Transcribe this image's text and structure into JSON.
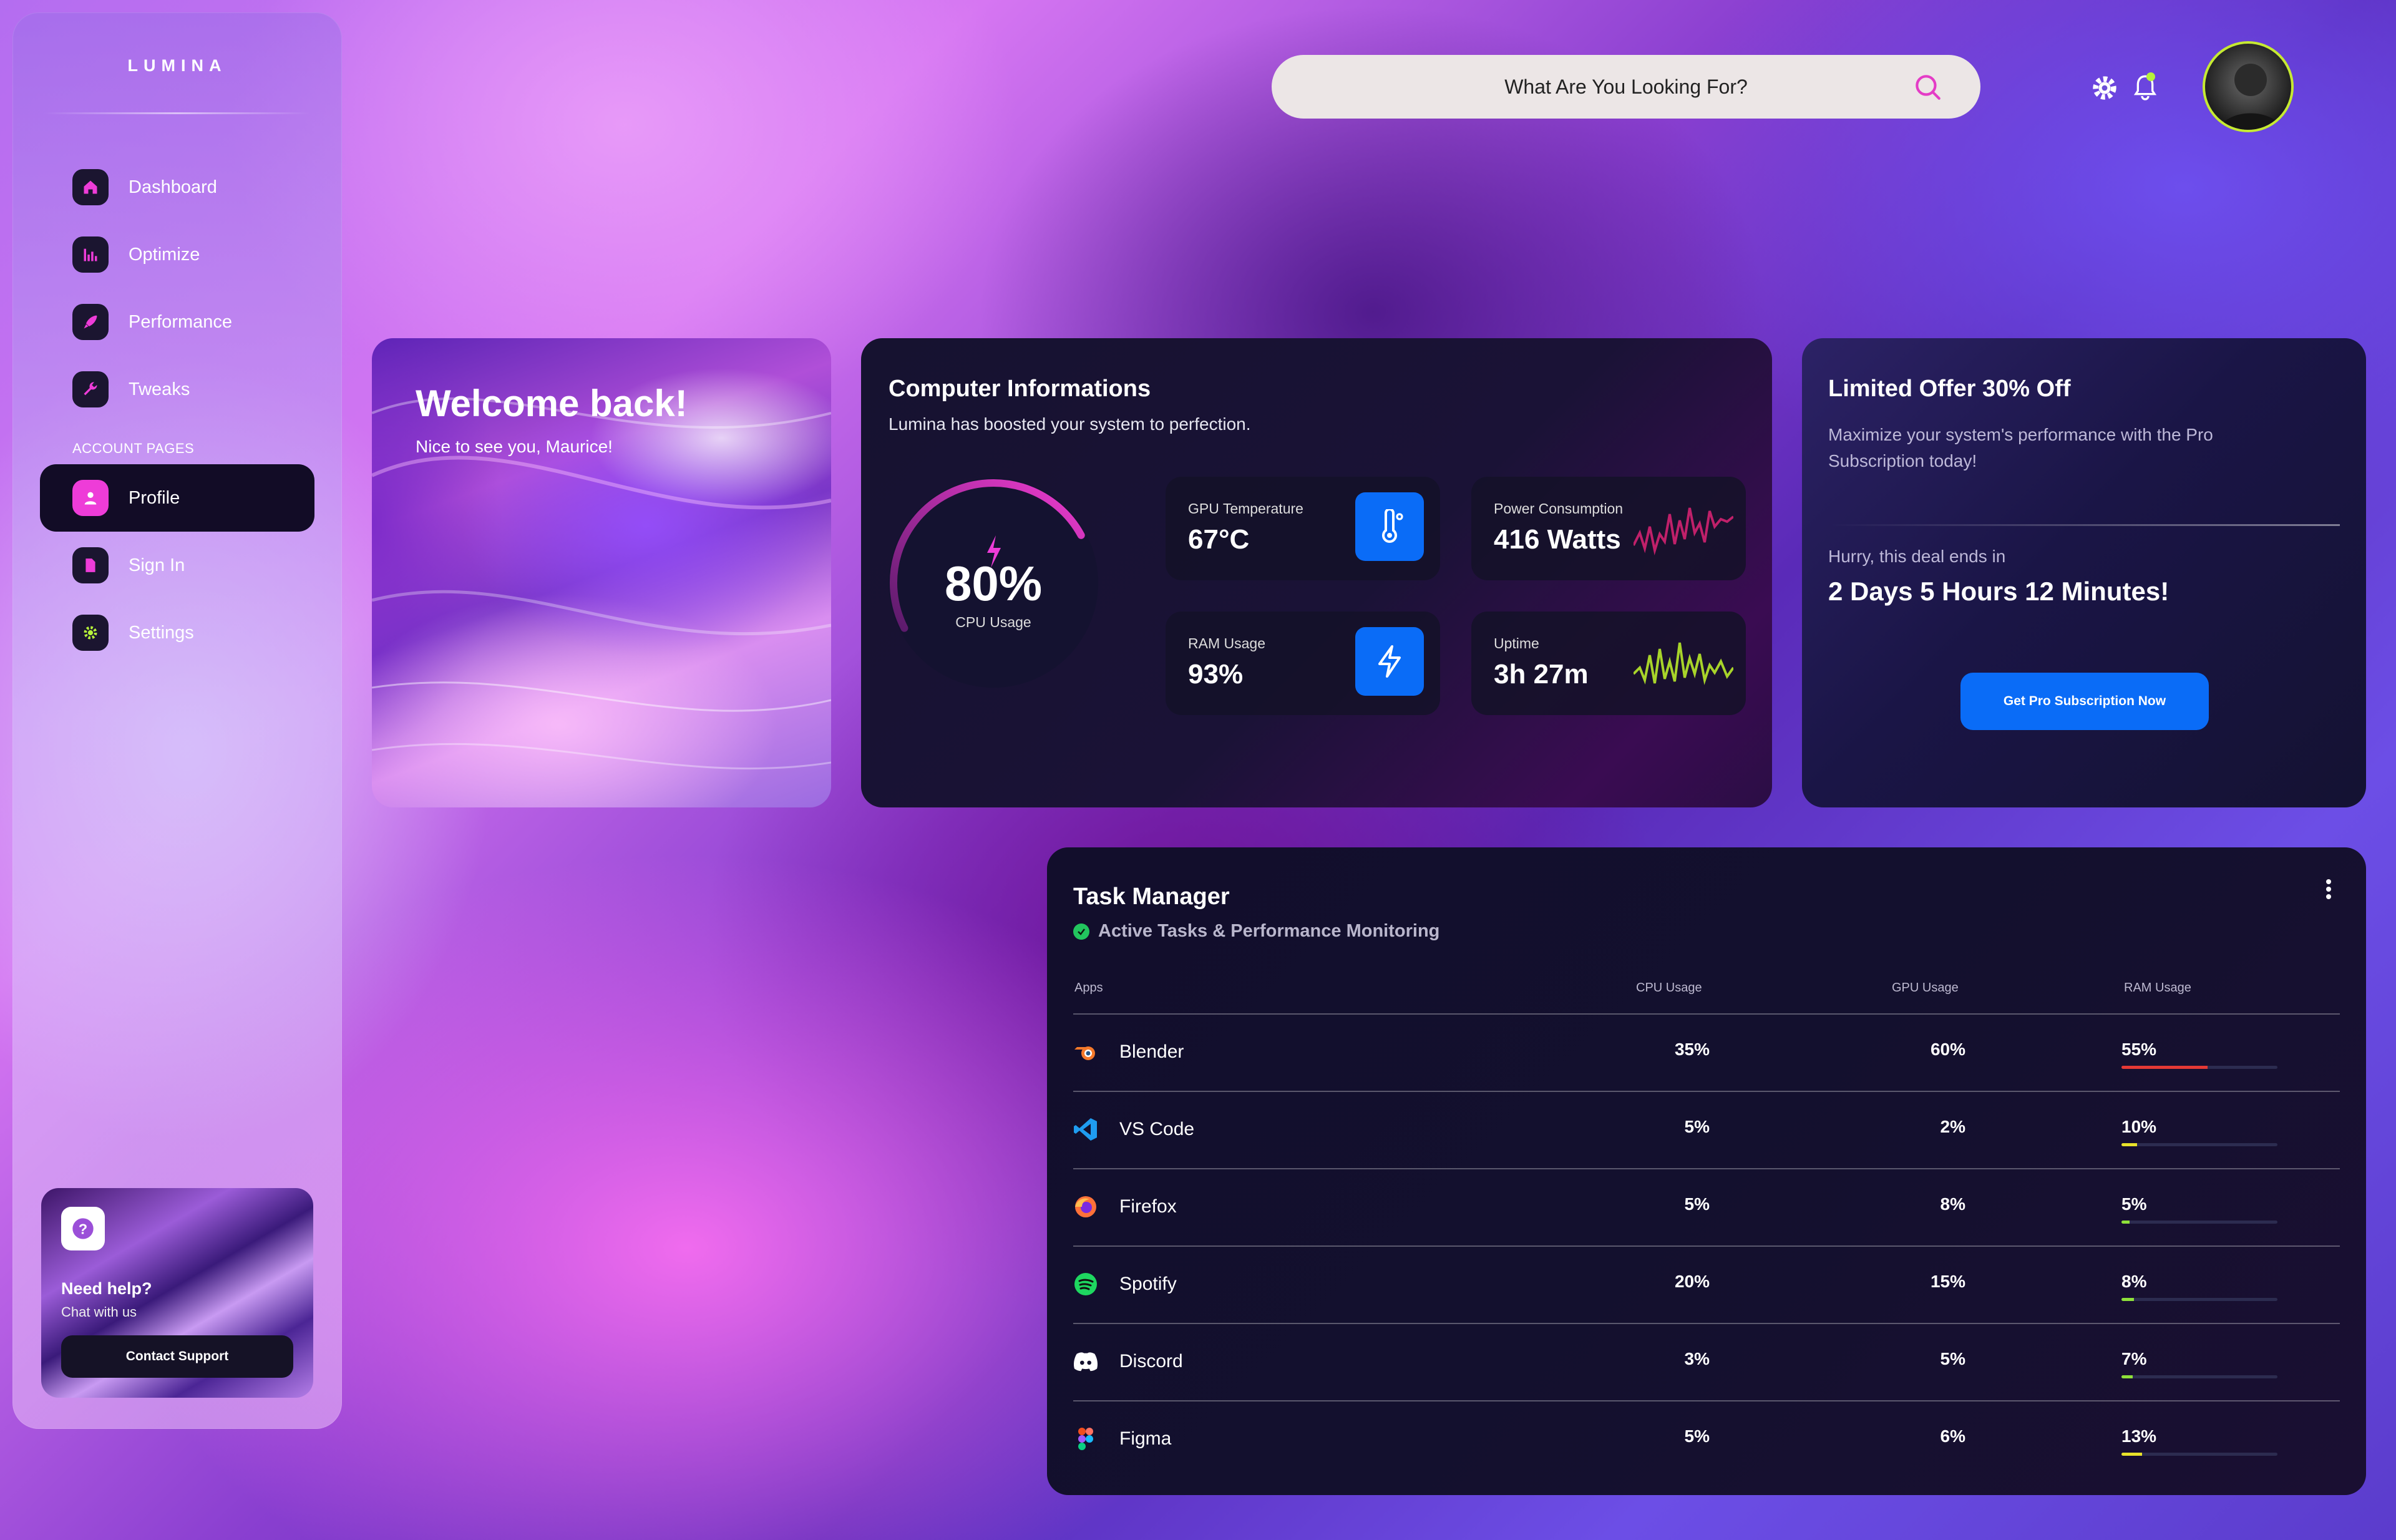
{
  "brand": {
    "logo": "LUMINA"
  },
  "sidebar": {
    "items": [
      {
        "label": "Dashboard",
        "icon": "home-icon"
      },
      {
        "label": "Optimize",
        "icon": "bar-chart-icon"
      },
      {
        "label": "Performance",
        "icon": "rocket-icon"
      },
      {
        "label": "Tweaks",
        "icon": "wrench-icon"
      }
    ],
    "section_label": "ACCOUNT PAGES",
    "account_items": [
      {
        "label": "Profile",
        "icon": "user-icon",
        "active": true
      },
      {
        "label": "Sign In",
        "icon": "document-icon"
      },
      {
        "label": "Settings",
        "icon": "gear-icon"
      }
    ],
    "help": {
      "title": "Need help?",
      "subtitle": "Chat with us",
      "button": "Contact Support",
      "icon": "question-icon"
    }
  },
  "header": {
    "search_placeholder": "What Are You Looking For?",
    "icons": [
      "search-icon",
      "gear-icon",
      "bell-icon",
      "avatar"
    ]
  },
  "welcome": {
    "title": "Welcome back!",
    "subtitle": "Nice to see you, Maurice!"
  },
  "computer": {
    "title": "Computer Informations",
    "subtitle": "Lumina has boosted your system to perfection.",
    "cpu": {
      "value": "80%",
      "label": "CPU Usage",
      "fraction": 0.8
    },
    "stats": [
      {
        "label": "GPU Temperature",
        "value": "67°C",
        "icon": "thermometer-icon"
      },
      {
        "label": "Power Consumption",
        "value": "416 Watts",
        "icon": "waveform-chart-icon"
      },
      {
        "label": "RAM Usage",
        "value": "93%",
        "icon": "lightning-icon"
      },
      {
        "label": "Uptime",
        "value": "3h 27m",
        "icon": "waveform-chart-icon"
      }
    ]
  },
  "offer": {
    "title": "Limited Offer 30% Off",
    "text": "Maximize your system's performance with the Pro Subscription today!",
    "hurry": "Hurry, this deal ends in",
    "countdown": "2 Days 5 Hours 12 Minutes!",
    "button": "Get Pro Subscription Now"
  },
  "tasks": {
    "title": "Task Manager",
    "subtitle": "Active Tasks & Performance Monitoring",
    "columns": [
      "Apps",
      "CPU Usage",
      "GPU Usage",
      "RAM Usage"
    ],
    "rows": [
      {
        "app": "Blender",
        "cpu": "35%",
        "gpu": "60%",
        "ram": "55%",
        "ram_fraction": 0.55,
        "bar_color": "#e53935",
        "icon": "blender-icon"
      },
      {
        "app": "VS Code",
        "cpu": "5%",
        "gpu": "2%",
        "ram": "10%",
        "ram_fraction": 0.1,
        "bar_color": "#e8e22a",
        "icon": "vscode-icon"
      },
      {
        "app": "Firefox",
        "cpu": "5%",
        "gpu": "8%",
        "ram": "5%",
        "ram_fraction": 0.05,
        "bar_color": "#8ee03a",
        "icon": "firefox-icon"
      },
      {
        "app": "Spotify",
        "cpu": "20%",
        "gpu": "15%",
        "ram": "8%",
        "ram_fraction": 0.08,
        "bar_color": "#8ee03a",
        "icon": "spotify-icon"
      },
      {
        "app": "Discord",
        "cpu": "3%",
        "gpu": "5%",
        "ram": "7%",
        "ram_fraction": 0.07,
        "bar_color": "#8ee03a",
        "icon": "discord-icon"
      },
      {
        "app": "Figma",
        "cpu": "5%",
        "gpu": "6%",
        "ram": "13%",
        "ram_fraction": 0.13,
        "bar_color": "#e8e22a",
        "icon": "figma-icon"
      }
    ]
  },
  "colors": {
    "accent": "#ee3cd8",
    "blue": "#0a6cf7",
    "lime": "#c6ea32"
  }
}
